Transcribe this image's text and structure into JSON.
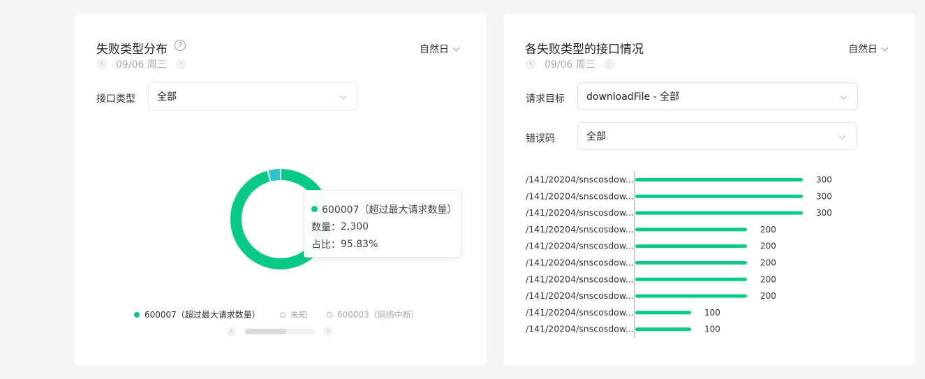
{
  "colors": {
    "accent": "#08c986",
    "secondary": "#2ec7c9"
  },
  "left_card": {
    "title": "失败类型分布",
    "help_icon": "?",
    "date_prev_icon": "‹",
    "date": "09/06 周三",
    "date_next_icon": "›",
    "period": "自然日",
    "filter_label": "接口类型",
    "filter_value": "全部",
    "tooltip": {
      "name": "600007（超过最大请求数量）",
      "count_label": "数量：",
      "count_value": "2,300",
      "ratio_label": "占比：",
      "ratio_value": "95.83%"
    },
    "legend": [
      {
        "label": "600007（超过最大请求数量）",
        "active": true
      },
      {
        "label": "未知",
        "active": false
      },
      {
        "label": "600003（网络中断）",
        "active": false
      }
    ],
    "pager_prev_icon": "‹",
    "pager_next_icon": "›",
    "pager_scroll_fraction": 0.59
  },
  "right_card": {
    "title": "各失败类型的接口情况",
    "date_prev_icon": "‹",
    "date": "09/06 周三",
    "date_next_icon": "›",
    "period": "自然日",
    "target_label": "请求目标",
    "target_value": "downloadFile - 全部",
    "error_label": "错误码",
    "error_value": "全部"
  },
  "chart_data": [
    {
      "type": "pie",
      "labels": [
        "600007（超过最大请求数量）",
        "未知"
      ],
      "values": [
        95.83,
        4.17
      ],
      "colors": [
        "#08c986",
        "#2ec7c9"
      ]
    },
    {
      "type": "bar",
      "orientation": "horizontal",
      "categories": [
        "/141/20204/snscosdow...",
        "/141/20204/snscosdow...",
        "/141/20204/snscosdow...",
        "/141/20204/snscosdow...",
        "/141/20204/snscosdow...",
        "/141/20204/snscosdow...",
        "/141/20204/snscosdow...",
        "/141/20204/snscosdow...",
        "/141/20204/snscosdow...",
        "/141/20204/snscosdow..."
      ],
      "values": [
        300,
        300,
        300,
        200,
        200,
        200,
        200,
        200,
        100,
        100
      ],
      "xlim": [
        0,
        375
      ],
      "color": "#08c986"
    }
  ]
}
